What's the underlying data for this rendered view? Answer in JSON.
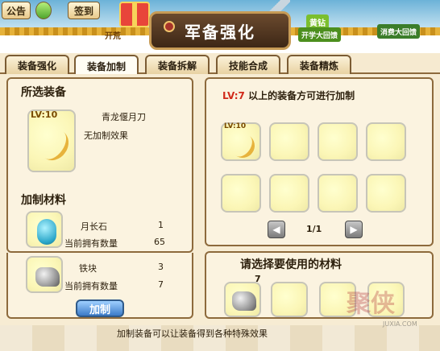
{
  "topbar": {
    "announce_label": "公告",
    "signin_label": "签到",
    "promo_left": "开荒",
    "promo_gold": "黄钻",
    "promo_gold_sub": "开学大回馈",
    "promo_consume": "消费大回馈"
  },
  "title": "军备强化",
  "tabs": [
    {
      "label": "装备强化"
    },
    {
      "label": "装备加制"
    },
    {
      "label": "装备拆解"
    },
    {
      "label": "技能合成"
    },
    {
      "label": "装备精炼"
    }
  ],
  "selected": {
    "section_title": "所选装备",
    "level": "LV:10",
    "name": "青龙偃月刀",
    "effect": "无加制效果"
  },
  "materials": {
    "section_title": "加制材料",
    "items": [
      {
        "name": "月长石",
        "need": "1",
        "owned_label": "当前拥有数量",
        "owned": "65",
        "icon": "moonstone-icon"
      },
      {
        "name": "铁块",
        "need": "3",
        "owned_label": "当前拥有数量",
        "owned": "7",
        "icon": "iron-ore-icon"
      }
    ],
    "make_button": "加制"
  },
  "requirement": {
    "level_prefix": "LV:",
    "level_value": "7",
    "text": "以上的装备方可进行加制"
  },
  "grid": {
    "first_level": "LV:10",
    "page": "1/1"
  },
  "material_select": {
    "title": "请选择要使用的材料",
    "first_count": "7"
  },
  "footer": {
    "hint": "加制装备可以让装备得到各种特殊效果",
    "watermark": "聚侠",
    "watermark_sub": "JUXIA.COM"
  },
  "colors": {
    "accent": "#8d6a3c",
    "level_red": "#d12a1a",
    "button_blue": "#3c7bc8"
  }
}
